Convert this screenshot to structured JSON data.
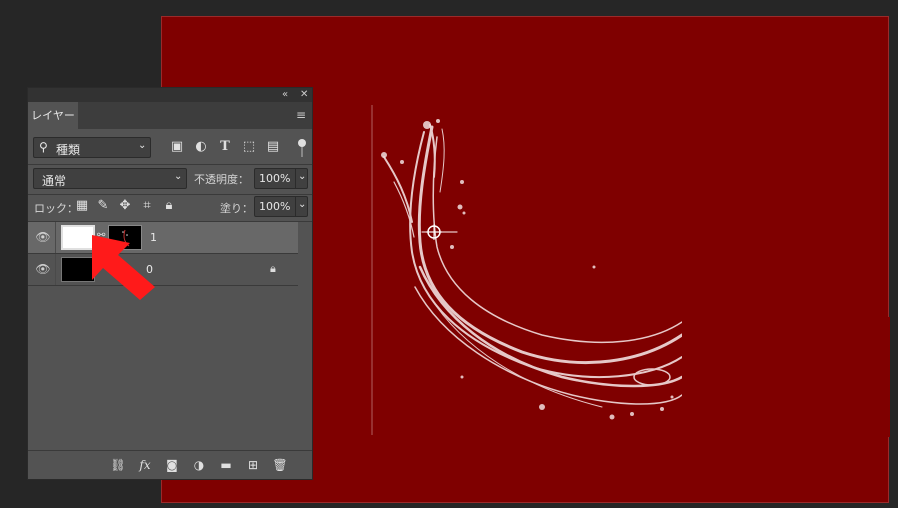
{
  "panel": {
    "tab_label": "レイヤー",
    "filter": {
      "icon": "search-icon",
      "value": "種類"
    },
    "blend_mode": "通常",
    "opacity_label": "不透明度：",
    "opacity_value": "100%",
    "lock_label": "ロック：",
    "fill_label": "塗り：",
    "fill_value": "100%",
    "layers": [
      {
        "name": "1",
        "visible": true,
        "selected": true,
        "thumbnail": "white",
        "mask": "splash"
      },
      {
        "name": "0",
        "visible": true,
        "selected": false,
        "thumbnail": "black",
        "locked": true
      }
    ],
    "bottom_icons": [
      "link-icon",
      "fx-icon",
      "mask-icon",
      "adjustment-icon",
      "folder-icon",
      "new-layer-icon",
      "trash-icon"
    ]
  },
  "colors": {
    "canvas_bg": "#7f0000",
    "arrow": "#ff0000"
  }
}
